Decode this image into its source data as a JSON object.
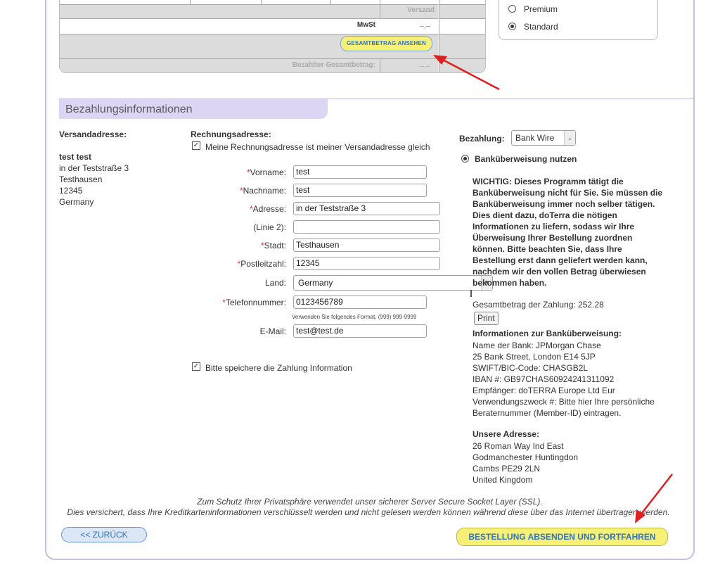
{
  "summary": {
    "shipping_label": "Versand",
    "shipping_value": "--,--",
    "vat_label": "MwSt",
    "vat_value": "--,--",
    "show_total_button": "GESAMTBETRAG ANSEHEN",
    "paid_total_label": "Bezahlter Gesamtbetrag:",
    "paid_total_value": "--,--"
  },
  "shipping_options": [
    {
      "label": "Premium",
      "selected": false
    },
    {
      "label": "Standard",
      "selected": true
    }
  ],
  "section_title": "Bezahlungsinformationen",
  "shipping_address": {
    "heading": "Versandadresse:",
    "name": "test test",
    "street": "in der Teststraße 3",
    "city": "Testhausen",
    "zip": "12345",
    "country": "Germany"
  },
  "billing": {
    "heading": "Rechnungsadresse:",
    "same_as_shipping": "Meine Rechnungsadresse ist meiner Versandadresse gleich",
    "fields": {
      "first_name": {
        "label": "Vorname:",
        "value": "test"
      },
      "last_name": {
        "label": "Nachname:",
        "value": "test"
      },
      "address": {
        "label": "Adresse:",
        "value": "in der Teststraße 3"
      },
      "line2": {
        "label": "(Linie 2):",
        "value": ""
      },
      "city": {
        "label": "Stadt:",
        "value": "Testhausen"
      },
      "zip": {
        "label": "Postleitzahl:",
        "value": "12345"
      },
      "country": {
        "label": "Land:",
        "value": "Germany"
      },
      "phone": {
        "label": "Telefonnummer:",
        "value": "0123456789"
      },
      "email": {
        "label": "E-Mail:",
        "value": "test@test.de"
      }
    },
    "required_mark": "*",
    "phone_hint": "Verwenden Sie folgendes Format, (999) 999-9999",
    "save_payment": "Bitte speichere die Zahlung Information"
  },
  "payment": {
    "label": "Bezahlung:",
    "method": "Bank Wire",
    "option": "Banküberweisung nutzen",
    "important": [
      "WICHTIG: Dieses Programm tätigt die",
      "Banküberweisung nicht für Sie. Sie müssen die",
      "Banküberweisung immer noch selber tätigen.",
      "Dies dient dazu, doTerra die nötigen",
      "Informationen zu liefern, sodass wir Ihre",
      "Überweisung Ihrer Bestellung zuordnen",
      "können. Bitte beachten Sie, dass Ihre",
      "Bestellung erst dann geliefert werden kann,",
      "nachdem wir den vollen Betrag überwiesen",
      "bekommen haben."
    ],
    "total": "Gesamtbetrag der Zahlung: 252.28",
    "print_button": "Print",
    "bank_heading": "Informationen zur Banküberweisung:",
    "bank_lines": [
      "Name der Bank: JPMorgan Chase",
      "25 Bank Street, London E14 5JP",
      "SWIFT/BIC-Code: CHASGB2L",
      "IBAN #: GB97CHAS60924241311092",
      "Empfänger: doTERRA Europe Ltd Eur",
      "Verwendungszweck #: Bitte hier Ihre persönliche",
      "Beraternummer (Member-ID) eintragen."
    ],
    "address_heading": "Unsere Adresse:",
    "address_lines": [
      "26 Roman Way Ind East",
      "Godmanchester Huntingdon",
      "Cambs PE29 2LN",
      "United Kingdom"
    ]
  },
  "ssl_notice": [
    "Zum Schutz Ihrer Privatsphäre verwendet unser sicherer Server Secure Socket Layer (SSL).",
    "Dies versichert, dass Ihre Kreditkarteninformationen verschlüsselt werden und nicht gelesen werden können während diese über das Internet übertragen werden."
  ],
  "buttons": {
    "back": "<< ZURÜCK",
    "submit": "BESTELLUNG ABSENDEN UND FORTFAHREN"
  },
  "colors": {
    "accent_purple": "#ddd5f4",
    "button_yellow": "#f6f077",
    "button_blue_text": "#2e74c4",
    "annotation_red": "#e02020"
  }
}
